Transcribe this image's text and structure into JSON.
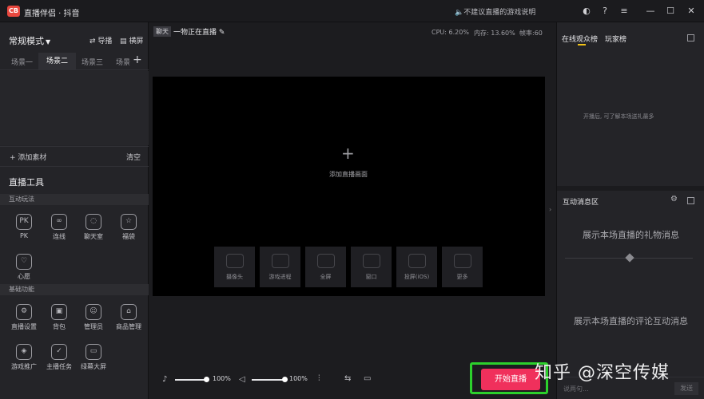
{
  "app": {
    "logo_text": "CB",
    "title": "直播伴侣 · 抖音",
    "notice": "🔈不建议直播的游戏说明"
  },
  "window": {
    "icons": [
      "settings-icon",
      "help-icon",
      "menu-icon",
      "minimize-icon",
      "maximize-icon",
      "close-icon"
    ]
  },
  "left": {
    "mode": "常规模式",
    "link_import": "导播",
    "link_landscape": "横屏",
    "scenes": [
      "场景一",
      "场景二",
      "场景三",
      "场景"
    ],
    "add_source": "+ 添加素材",
    "clear": "清空",
    "tools_title": "直播工具",
    "section_interactive": "互动玩法",
    "interactive": [
      {
        "label": "PK",
        "glyph": "PK"
      },
      {
        "label": "连线",
        "glyph": "∞"
      },
      {
        "label": "聊天室",
        "glyph": "◌"
      },
      {
        "label": "福袋",
        "glyph": "☆"
      },
      {
        "label": "心愿",
        "glyph": "♡"
      }
    ],
    "section_basic": "基础功能",
    "basic": [
      {
        "label": "直播设置",
        "glyph": "⚙"
      },
      {
        "label": "背包",
        "glyph": "▣"
      },
      {
        "label": "管理员",
        "glyph": "☺"
      },
      {
        "label": "商品管理",
        "glyph": "⌂"
      },
      {
        "label": "游戏推广",
        "glyph": "◈"
      },
      {
        "label": "主播任务",
        "glyph": "✓"
      },
      {
        "label": "绿幕大屏",
        "glyph": "▭"
      }
    ]
  },
  "stage": {
    "tag": "聊天",
    "title": "一物正在直播",
    "cpu": "CPU: 6.20%",
    "mem": "内存: 13.60%",
    "fps": "帧率:60",
    "add_label": "添加直播画面",
    "quick": [
      "摄像头",
      "游戏进程",
      "全屏",
      "窗口",
      "投屏(iOS)",
      "更多"
    ]
  },
  "bottom": {
    "mic_volume": "100%",
    "speaker_volume": "100%",
    "mic_level": 1.0,
    "speaker_level": 1.0,
    "start_label": "开始直播"
  },
  "right": {
    "tab_audience": "在线观众榜",
    "tab_players": "玩家榜",
    "hint": "开播后, 可了解本场送礼最多",
    "section_title": "互动消息区",
    "gift_msg": "展示本场直播的礼物消息",
    "comment_msg": "展示本场直播的评论互动消息",
    "input_placeholder": "说两句...",
    "send": "发送"
  },
  "watermark": "知乎 @深空传媒",
  "colors": {
    "accent_start": "#f0305c",
    "highlight_border": "#2cd02c",
    "tab_underline": "#f2c318"
  }
}
